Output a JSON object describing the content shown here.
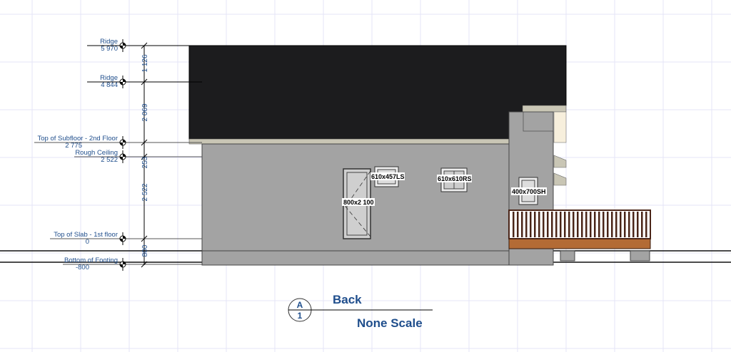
{
  "levels": [
    {
      "name": "Ridge",
      "elevation": "5 970"
    },
    {
      "name": "Ridge",
      "elevation": "4 844"
    },
    {
      "name": "Top of Subfloor - 2nd Floor",
      "elevation": "2 775"
    },
    {
      "name": "Rough Ceiling",
      "elevation": "2 522"
    },
    {
      "name": "Top of Slab - 1st floor",
      "elevation": "0"
    },
    {
      "name": "Bottom of Footing",
      "elevation": "-800"
    }
  ],
  "dimensions": [
    "1 126",
    "2 069",
    "253",
    "2 522",
    "800"
  ],
  "tags": {
    "door": "800x2 100",
    "window1": "610x457LS",
    "window2": "610x610RS",
    "window3": "400x700SH"
  },
  "view_title": {
    "name": "Back",
    "scale": "None Scale",
    "detail": "A",
    "sheet": "1"
  },
  "colors": {
    "annotation": "#1f4e8c",
    "roof": "#1c1c1e",
    "wall": "#a3a3a3",
    "deck": "#b36b35",
    "railing": "#4a2518",
    "grid": "#e4e4f7"
  }
}
